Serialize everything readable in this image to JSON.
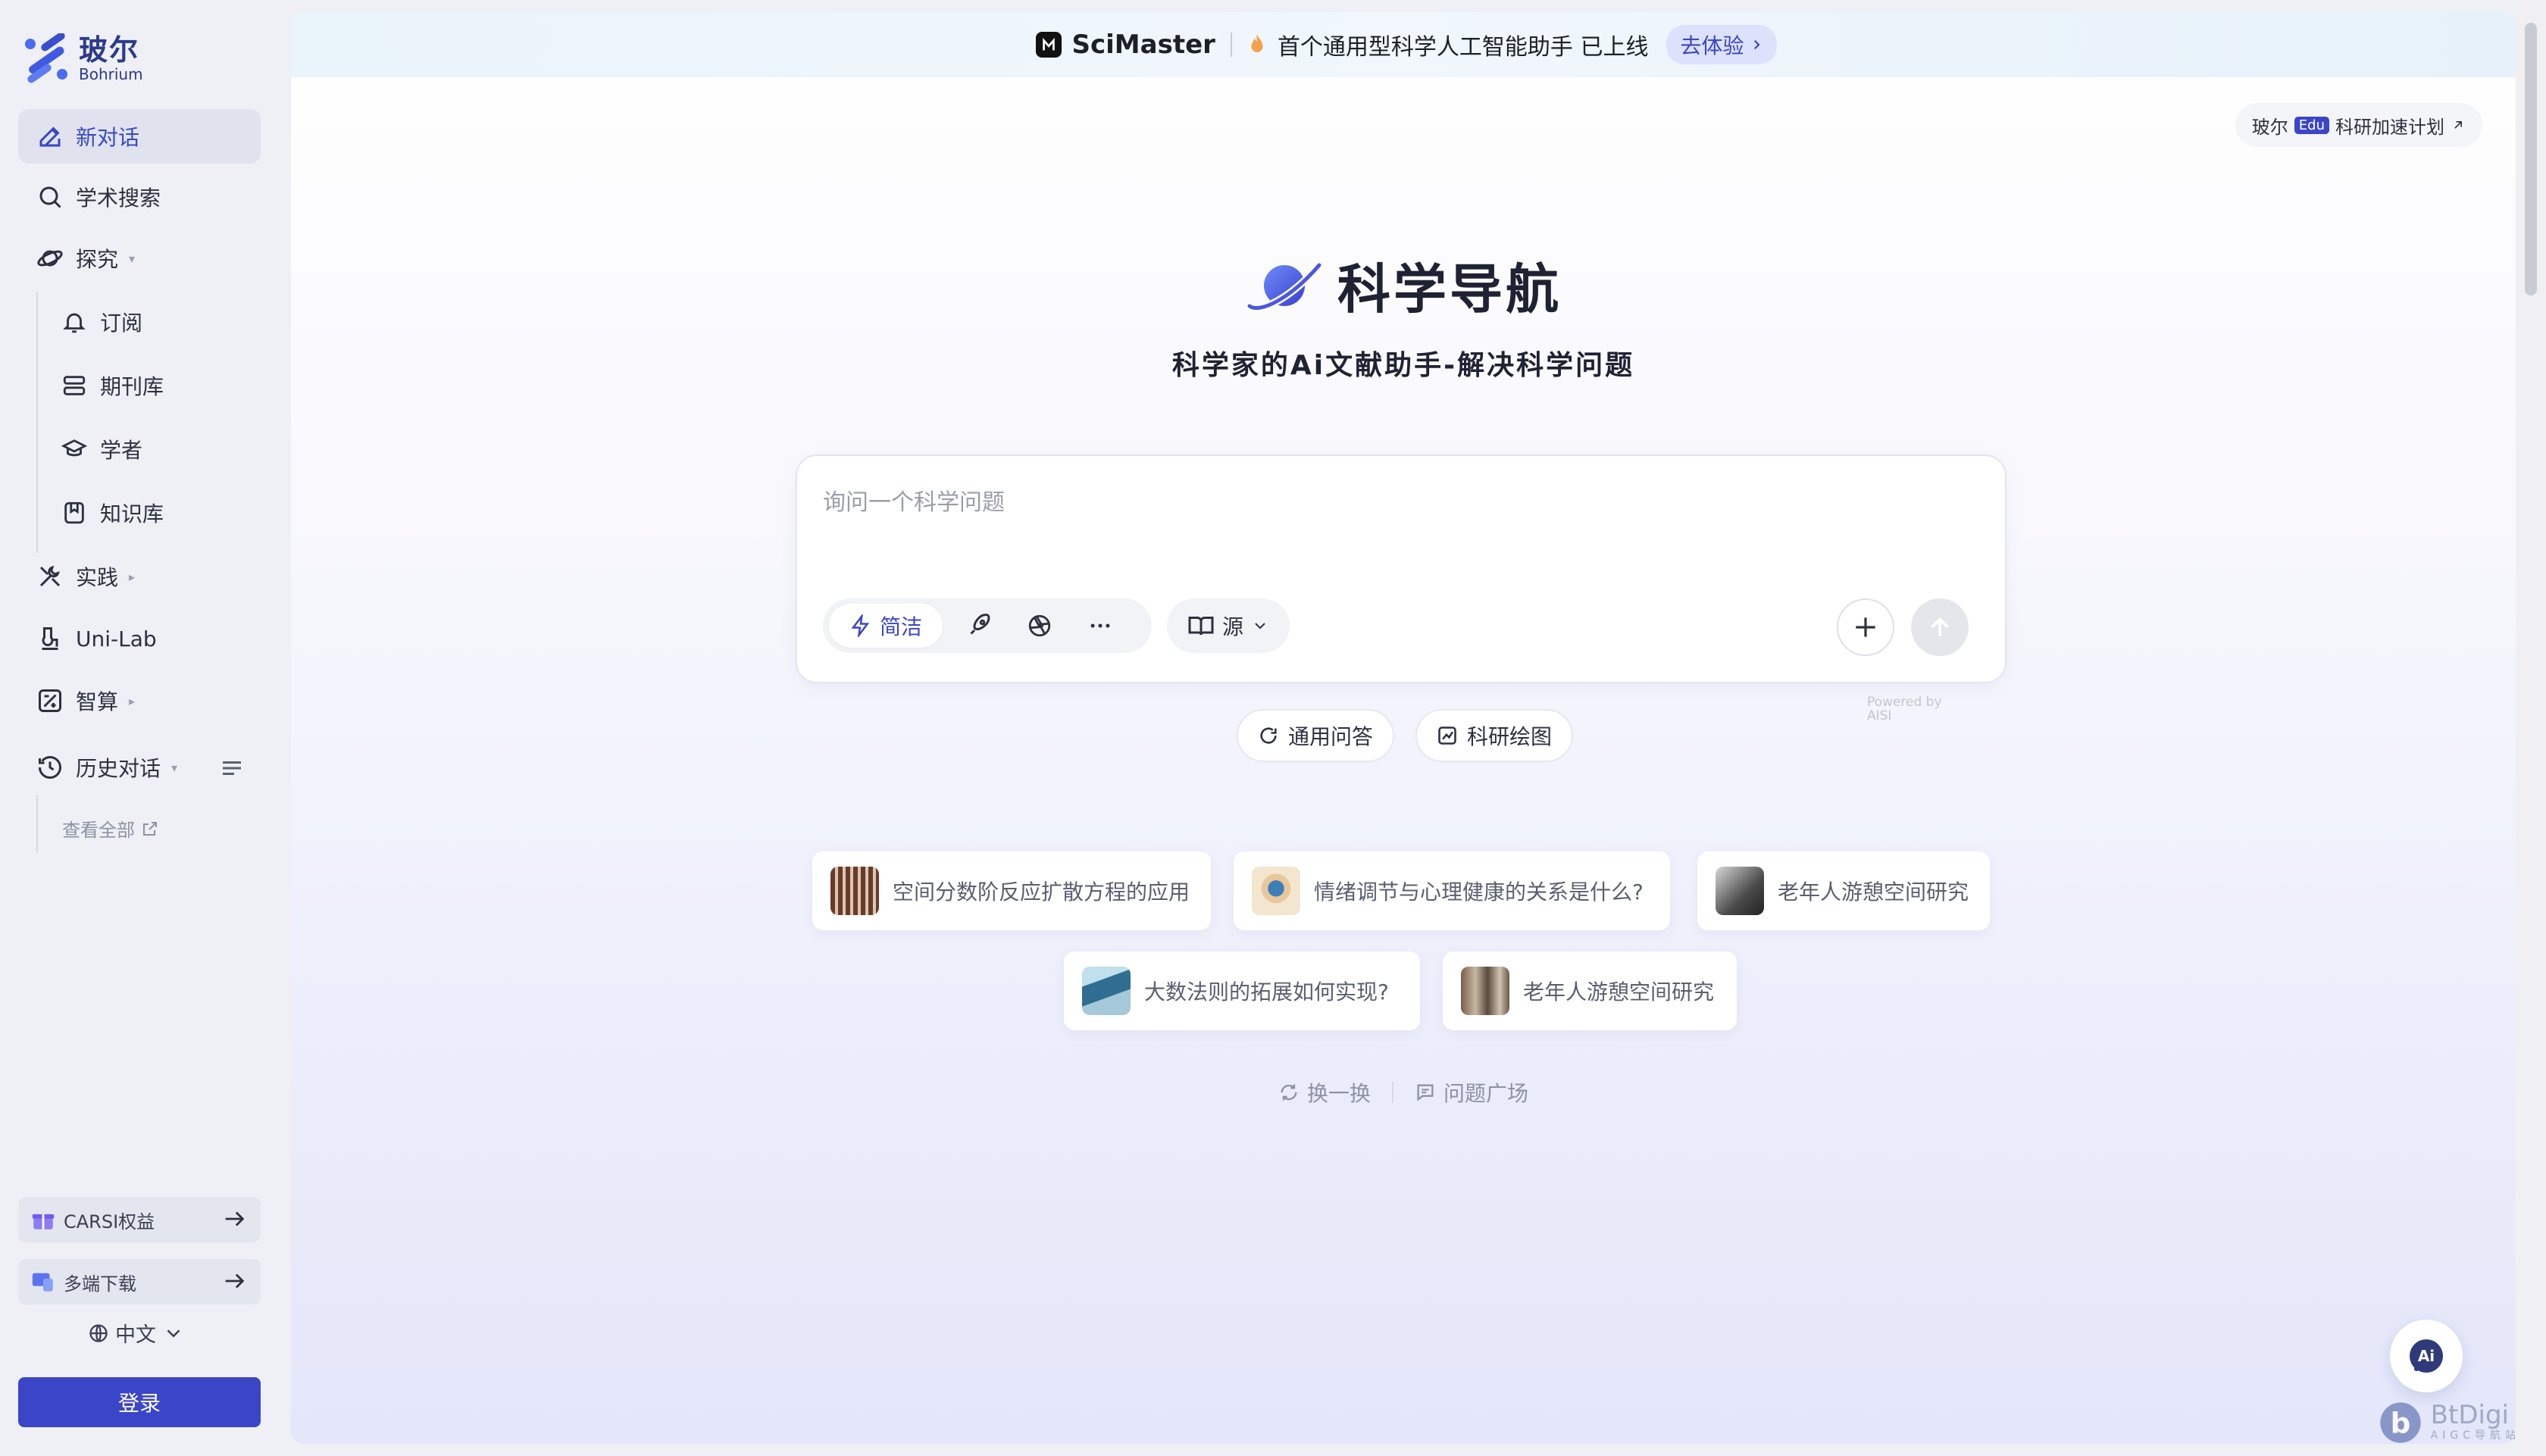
{
  "brand": {
    "name_cn": "玻尔",
    "name_en": "Bohrium"
  },
  "sidebar": {
    "items": [
      {
        "label": "新对话",
        "icon": "edit-icon",
        "active": true
      },
      {
        "label": "学术搜索",
        "icon": "search-icon"
      },
      {
        "label": "探究",
        "icon": "planet-icon",
        "caret": "▾"
      },
      {
        "label": "订阅",
        "icon": "bell-icon"
      },
      {
        "label": "期刊库",
        "icon": "database-icon"
      },
      {
        "label": "学者",
        "icon": "graduation-cap-icon"
      },
      {
        "label": "知识库",
        "icon": "bookmark-icon"
      },
      {
        "label": "实践",
        "icon": "tools-icon",
        "caret": "▸"
      },
      {
        "label": "Uni-Lab",
        "icon": "lab-icon"
      },
      {
        "label": "智算",
        "icon": "compute-icon",
        "caret": "▸"
      },
      {
        "label": "历史对话",
        "icon": "history-icon",
        "caret": "▾"
      }
    ],
    "view_all": "查看全部",
    "promos": [
      {
        "label": "CARSI权益",
        "icon": "gift-icon"
      },
      {
        "label": "多端下载",
        "icon": "devices-icon"
      }
    ],
    "language": "中文",
    "login": "登录"
  },
  "banner": {
    "product": "SciMaster",
    "text": "首个通用型科学人工智能助手  已上线",
    "cta": "去体验"
  },
  "edu": {
    "prefix": "玻尔",
    "badge": "Edu",
    "label": "科研加速计划"
  },
  "hero": {
    "title": "科学导航",
    "subtitle": "科学家的Ai文献助手-解决科学问题"
  },
  "composer": {
    "placeholder": "询问一个科学问题",
    "mode_active": "简洁",
    "source_label": "源"
  },
  "powered_by": "Powered by AISI",
  "chips": [
    {
      "label": "通用问答",
      "icon": "refresh-chat-icon"
    },
    {
      "label": "科研绘图",
      "icon": "chart-draw-icon"
    }
  ],
  "questions": [
    {
      "text": "空间分数阶反应扩散方程的应用"
    },
    {
      "text": "情绪调节与心理健康的关系是什么?"
    },
    {
      "text": "老年人游憩空间研究"
    },
    {
      "text": "大数法则的拓展如何实现?"
    },
    {
      "text": "老年人游憩空间研究"
    }
  ],
  "refresh": {
    "swap": "换一换",
    "square": "问题广场"
  },
  "watermark": {
    "title": "BtDigi",
    "sub": "AIGC导航站"
  },
  "colors": {
    "accent": "#3b45c8",
    "sidebar_bg": "#eef0f5"
  }
}
